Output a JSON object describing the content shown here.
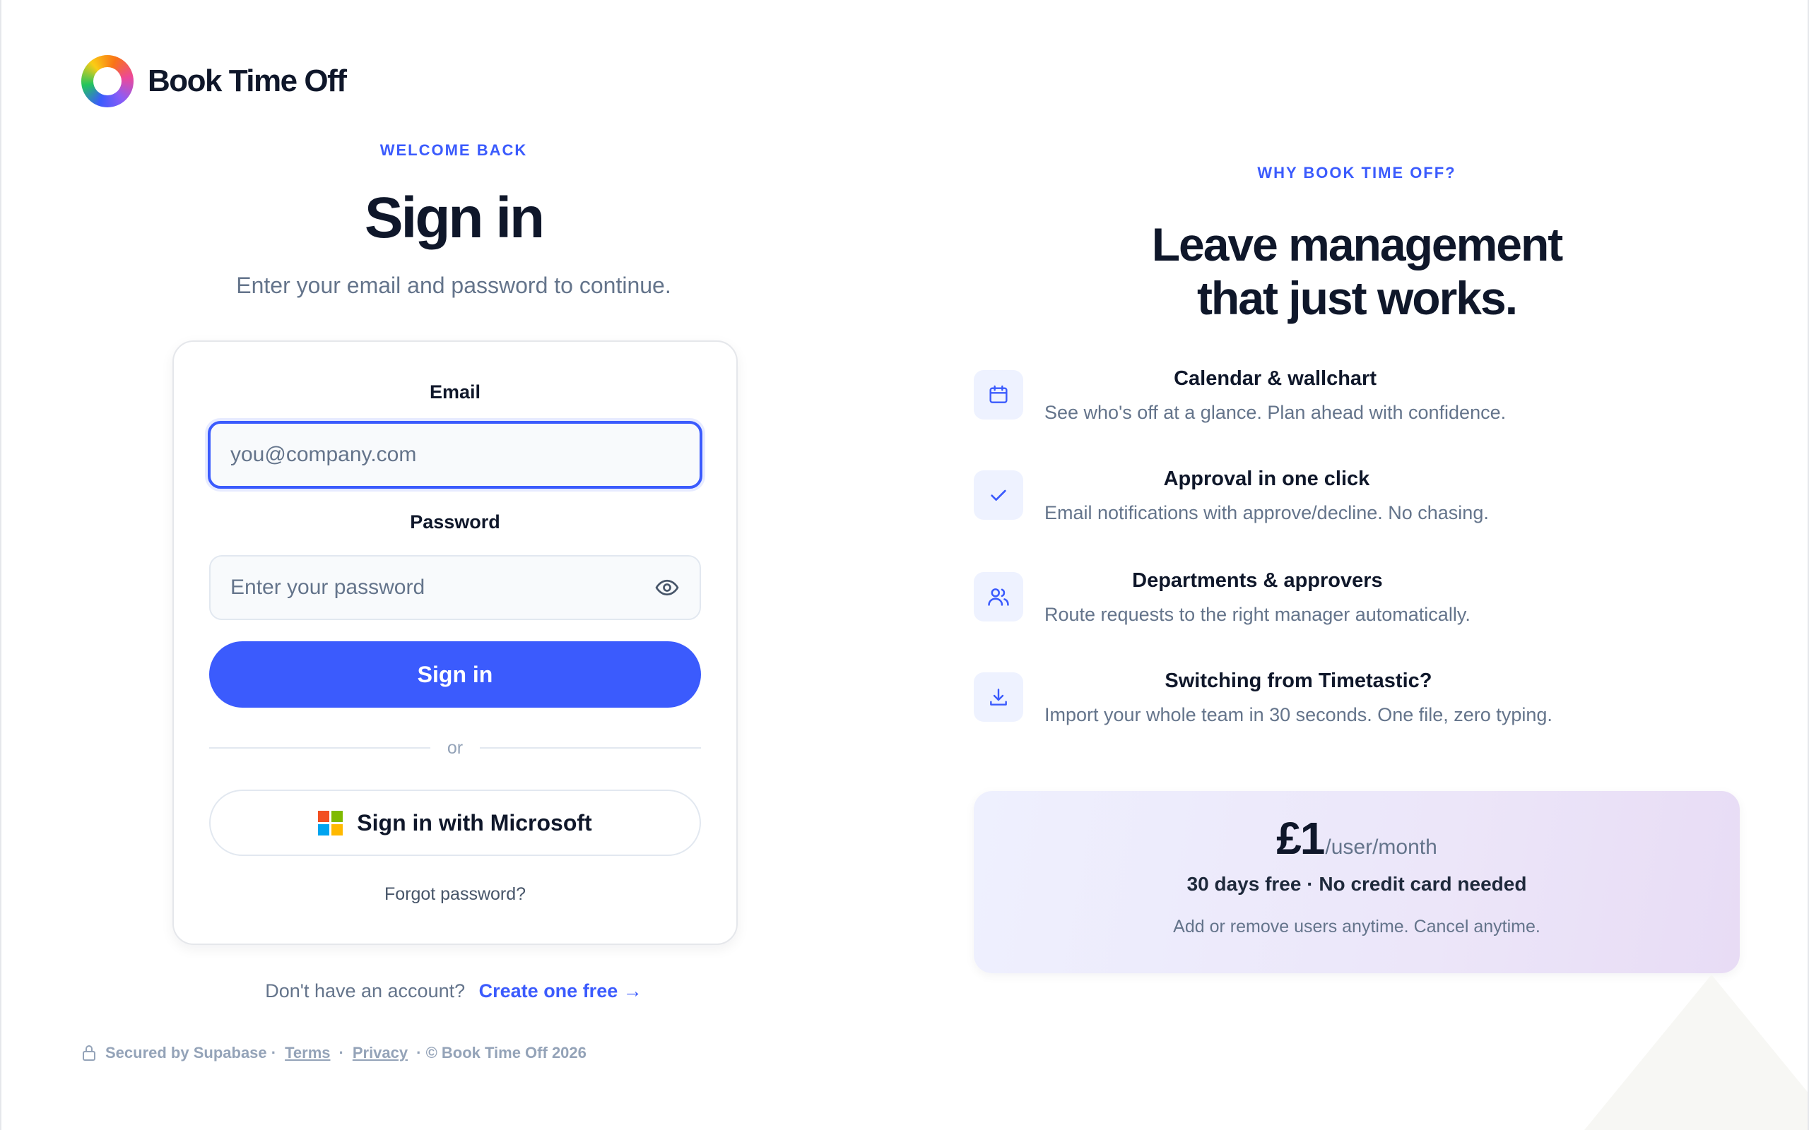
{
  "brand": {
    "name": "Book Time Off"
  },
  "signin": {
    "eyebrow": "WELCOME BACK",
    "title": "Sign in",
    "subtitle": "Enter your email and password to continue.",
    "email_label": "Email",
    "email_placeholder": "you@company.com",
    "email_value": "",
    "password_label": "Password",
    "password_placeholder": "Enter your password",
    "password_value": "",
    "submit_label": "Sign in",
    "divider_text": "or",
    "microsoft_label": "Sign in with Microsoft",
    "forgot_label": "Forgot password?"
  },
  "signup": {
    "prompt": "Don't have an account?",
    "link_label": "Create one free →"
  },
  "footer": {
    "secured": "Secured by Supabase ·",
    "terms": "Terms",
    "sep": "·",
    "privacy": "Privacy",
    "copyright": "· © Book Time Off 2026"
  },
  "why": {
    "eyebrow": "WHY BOOK TIME OFF?",
    "title_line1": "Leave management",
    "title_line2": "that just works.",
    "features": [
      {
        "icon": "calendar-icon",
        "title": "Calendar & wallchart",
        "desc": "See who's off at a glance. Plan ahead with confidence."
      },
      {
        "icon": "check-icon",
        "title": "Approval in one click",
        "desc": "Email notifications with approve/decline. No chasing."
      },
      {
        "icon": "users-icon",
        "title": "Departments & approvers",
        "desc": "Route requests to the right manager automatically."
      },
      {
        "icon": "download-icon",
        "title": "Switching from Timetastic?",
        "desc": "Import your whole team in 30 seconds. One file, zero typing."
      }
    ]
  },
  "pricing": {
    "amount": "£1",
    "unit": "/user/month",
    "trial": "30 days free · No credit card needed",
    "note": "Add or remove users anytime. Cancel anytime."
  },
  "colors": {
    "accent": "#3b5bfd",
    "text": "#0f172a",
    "muted": "#64748b"
  }
}
